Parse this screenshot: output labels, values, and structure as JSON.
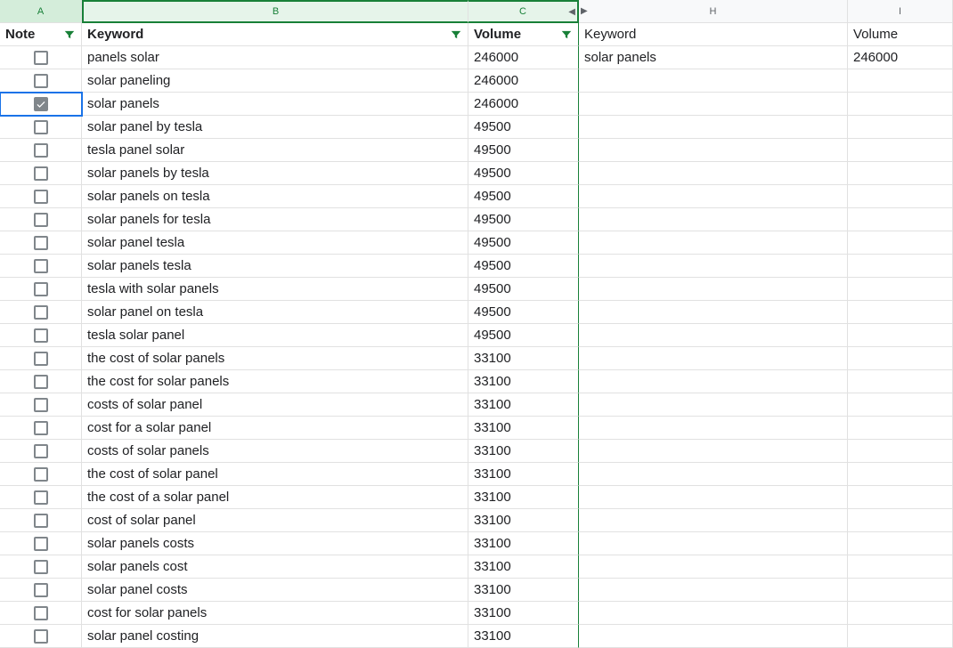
{
  "columns": [
    "A",
    "B",
    "C",
    "H",
    "I"
  ],
  "headers": {
    "A": "Note",
    "B": "Keyword",
    "C": "Volume",
    "H": "Keyword",
    "I": "Volume"
  },
  "rows": [
    {
      "checked": false,
      "keyword": "panels solar",
      "volume": "246000",
      "keyword2": "solar panels",
      "volume2": "246000"
    },
    {
      "checked": false,
      "keyword": "solar paneling",
      "volume": "246000",
      "keyword2": "",
      "volume2": ""
    },
    {
      "checked": true,
      "keyword": "solar panels",
      "volume": "246000",
      "keyword2": "",
      "volume2": ""
    },
    {
      "checked": false,
      "keyword": "solar panel by tesla",
      "volume": "49500",
      "keyword2": "",
      "volume2": ""
    },
    {
      "checked": false,
      "keyword": "tesla panel solar",
      "volume": "49500",
      "keyword2": "",
      "volume2": ""
    },
    {
      "checked": false,
      "keyword": "solar panels by tesla",
      "volume": "49500",
      "keyword2": "",
      "volume2": ""
    },
    {
      "checked": false,
      "keyword": "solar panels on tesla",
      "volume": "49500",
      "keyword2": "",
      "volume2": ""
    },
    {
      "checked": false,
      "keyword": "solar panels for tesla",
      "volume": "49500",
      "keyword2": "",
      "volume2": ""
    },
    {
      "checked": false,
      "keyword": "solar panel tesla",
      "volume": "49500",
      "keyword2": "",
      "volume2": ""
    },
    {
      "checked": false,
      "keyword": "solar panels tesla",
      "volume": "49500",
      "keyword2": "",
      "volume2": ""
    },
    {
      "checked": false,
      "keyword": "tesla with solar panels",
      "volume": "49500",
      "keyword2": "",
      "volume2": ""
    },
    {
      "checked": false,
      "keyword": "solar panel on tesla",
      "volume": "49500",
      "keyword2": "",
      "volume2": ""
    },
    {
      "checked": false,
      "keyword": "tesla solar panel",
      "volume": "49500",
      "keyword2": "",
      "volume2": ""
    },
    {
      "checked": false,
      "keyword": "the cost of solar panels",
      "volume": "33100",
      "keyword2": "",
      "volume2": ""
    },
    {
      "checked": false,
      "keyword": "the cost for solar panels",
      "volume": "33100",
      "keyword2": "",
      "volume2": ""
    },
    {
      "checked": false,
      "keyword": "costs of solar panel",
      "volume": "33100",
      "keyword2": "",
      "volume2": ""
    },
    {
      "checked": false,
      "keyword": "cost for a solar panel",
      "volume": "33100",
      "keyword2": "",
      "volume2": ""
    },
    {
      "checked": false,
      "keyword": "costs of solar panels",
      "volume": "33100",
      "keyword2": "",
      "volume2": ""
    },
    {
      "checked": false,
      "keyword": "the cost of solar panel",
      "volume": "33100",
      "keyword2": "",
      "volume2": ""
    },
    {
      "checked": false,
      "keyword": "the cost of a solar panel",
      "volume": "33100",
      "keyword2": "",
      "volume2": ""
    },
    {
      "checked": false,
      "keyword": "cost of solar panel",
      "volume": "33100",
      "keyword2": "",
      "volume2": ""
    },
    {
      "checked": false,
      "keyword": "solar panels costs",
      "volume": "33100",
      "keyword2": "",
      "volume2": ""
    },
    {
      "checked": false,
      "keyword": "solar panels cost",
      "volume": "33100",
      "keyword2": "",
      "volume2": ""
    },
    {
      "checked": false,
      "keyword": "solar panel costs",
      "volume": "33100",
      "keyword2": "",
      "volume2": ""
    },
    {
      "checked": false,
      "keyword": "cost for solar panels",
      "volume": "33100",
      "keyword2": "",
      "volume2": ""
    },
    {
      "checked": false,
      "keyword": "solar panel costing",
      "volume": "33100",
      "keyword2": "",
      "volume2": ""
    }
  ],
  "activeRowIndex": 2,
  "selectedColumns": [
    "B",
    "C"
  ]
}
